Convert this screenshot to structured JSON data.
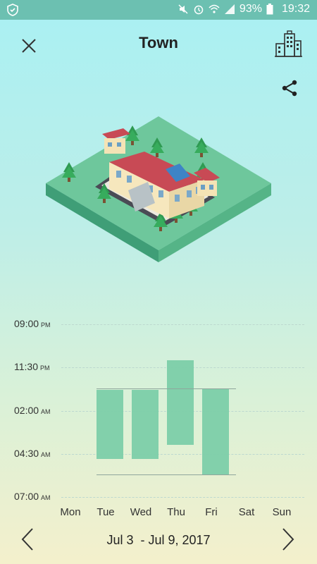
{
  "status_bar": {
    "battery": "93%",
    "time": "19:32",
    "icons": [
      "shield-icon",
      "mute-icon",
      "alarm-icon",
      "wifi-icon",
      "signal-icon",
      "battery-icon"
    ]
  },
  "header": {
    "title": "Town",
    "close_icon": "close-icon",
    "city_icon": "city-buildings-icon",
    "share_icon": "share-icon"
  },
  "chart_data": {
    "type": "bar",
    "categories": [
      "Mon",
      "Tue",
      "Wed",
      "Thu",
      "Fri",
      "Sat",
      "Sun"
    ],
    "y_ticks": [
      {
        "time": "09:00",
        "ampm": "PM"
      },
      {
        "time": "11:30",
        "ampm": "PM"
      },
      {
        "time": "02:00",
        "ampm": "AM"
      },
      {
        "time": "04:30",
        "ampm": "AM"
      },
      {
        "time": "07:00",
        "ampm": "AM"
      }
    ],
    "y_unit": "hours after 9:00 PM",
    "y_range": [
      0,
      10
    ],
    "sleep_intervals": [
      {
        "day": "Mon",
        "start": null,
        "end": null
      },
      {
        "day": "Tue",
        "start": 3.8,
        "end": 7.8
      },
      {
        "day": "Wed",
        "start": 3.8,
        "end": 7.8
      },
      {
        "day": "Thu",
        "start": 2.1,
        "end": 7.0
      },
      {
        "day": "Fri",
        "start": 3.7,
        "end": 8.7
      },
      {
        "day": "Sat",
        "start": null,
        "end": null
      },
      {
        "day": "Sun",
        "start": null,
        "end": null
      }
    ],
    "reference_lines": [
      3.7,
      8.7
    ],
    "grid": true,
    "bar_color": "#7ccda9"
  },
  "footer": {
    "date_range": "Jul 3  - Jul 9, 2017",
    "prev_icon": "chevron-left-icon",
    "next_icon": "chevron-right-icon"
  }
}
